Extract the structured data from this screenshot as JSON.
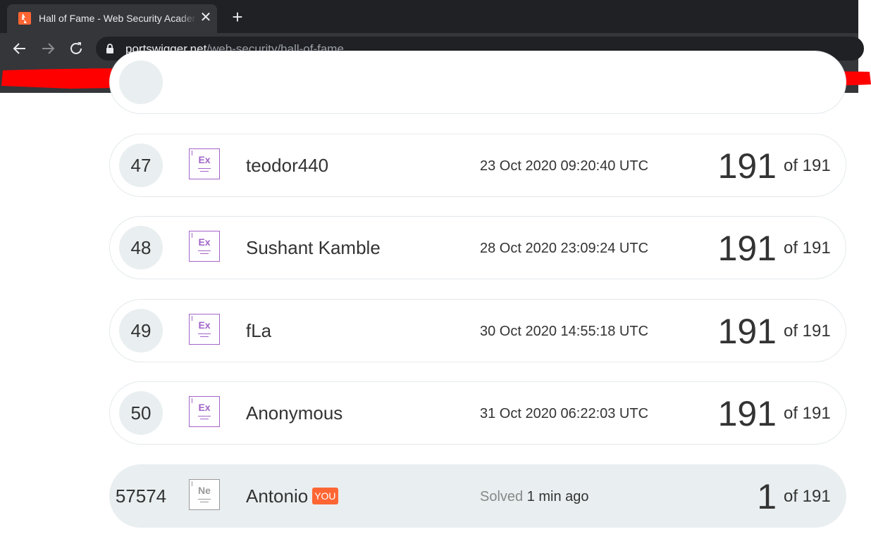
{
  "browser": {
    "tab_title": "Hall of Fame - Web Security Academy",
    "new_tab_label": "+",
    "close_label": "✕",
    "url_host": "portswigger.net",
    "url_path": "/web-security/hall-of-fame",
    "icons": {
      "favicon": "portswigger-logo-icon",
      "back": "back-arrow-icon",
      "forward": "forward-arrow-icon",
      "reload": "reload-icon",
      "lock": "lock-icon"
    }
  },
  "colors": {
    "accent": "#ff6633",
    "badge_purple": "#a264c9",
    "row_border": "#e4e9ec",
    "highlight_row": "#e9eef0",
    "redaction": "#ff0000"
  },
  "leaderboard": {
    "rows": [
      {
        "rank": "47",
        "badge": "Ex",
        "name": "teodor440",
        "date": "23 Oct 2020 09:20:40 UTC",
        "score": "191",
        "total": "of 191"
      },
      {
        "rank": "48",
        "badge": "Ex",
        "name": "Sushant Kamble",
        "date": "28 Oct 2020 23:09:24 UTC",
        "score": "191",
        "total": "of 191"
      },
      {
        "rank": "49",
        "badge": "Ex",
        "name": "fLa",
        "date": "30 Oct 2020 14:55:18 UTC",
        "score": "191",
        "total": "of 191"
      },
      {
        "rank": "50",
        "badge": "Ex",
        "name": "Anonymous",
        "date": "31 Oct 2020 06:22:03 UTC",
        "score": "191",
        "total": "of 191"
      }
    ],
    "you_row": {
      "rank": "57574",
      "badge": "Ne",
      "name": "Antonio",
      "you_tag": "YOU",
      "solved_prefix": "Solved",
      "solved_time": "1 min ago",
      "score": "1",
      "total": "of 191"
    }
  }
}
